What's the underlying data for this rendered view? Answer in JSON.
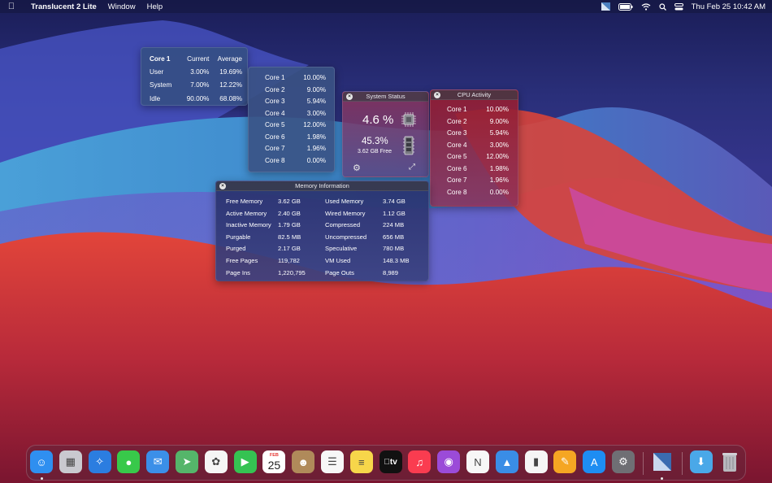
{
  "menubar": {
    "app_name": "Translucent 2 Lite",
    "menus": [
      "Window",
      "Help"
    ],
    "clock": "Thu Feb 25  10:42 AM"
  },
  "core_detail": {
    "headers": [
      "Core 1",
      "Current",
      "Average"
    ],
    "rows": [
      {
        "label": "User",
        "current": "3.00%",
        "average": "19.69%"
      },
      {
        "label": "System",
        "current": "7.00%",
        "average": "12.22%"
      },
      {
        "label": "Idle",
        "current": "90.00%",
        "average": "68.08%"
      }
    ]
  },
  "core_list": [
    {
      "name": "Core 1",
      "value": "10.00%"
    },
    {
      "name": "Core 2",
      "value": "9.00%"
    },
    {
      "name": "Core 3",
      "value": "5.94%"
    },
    {
      "name": "Core 4",
      "value": "3.00%"
    },
    {
      "name": "Core 5",
      "value": "12.00%"
    },
    {
      "name": "Core 6",
      "value": "1.98%"
    },
    {
      "name": "Core 7",
      "value": "1.96%"
    },
    {
      "name": "Core 8",
      "value": "0.00%"
    }
  ],
  "system_status": {
    "title": "System Status",
    "cpu_usage": "4.6 %",
    "memory_usage": "45.3%",
    "memory_free": "3.62 GB Free"
  },
  "cpu_activity": {
    "title": "CPU Activity",
    "cores": [
      {
        "name": "Core 1",
        "value": "10.00%"
      },
      {
        "name": "Core 2",
        "value": "9.00%"
      },
      {
        "name": "Core 3",
        "value": "5.94%"
      },
      {
        "name": "Core 4",
        "value": "3.00%"
      },
      {
        "name": "Core 5",
        "value": "12.00%"
      },
      {
        "name": "Core 6",
        "value": "1.98%"
      },
      {
        "name": "Core 7",
        "value": "1.96%"
      },
      {
        "name": "Core 8",
        "value": "0.00%"
      }
    ]
  },
  "memory_info": {
    "title": "Memory Information",
    "rows": [
      {
        "k1": "Free Memory",
        "v1": "3.62 GB",
        "k2": "Used Memory",
        "v2": "3.74 GB"
      },
      {
        "k1": "Active Memory",
        "v1": "2.40 GB",
        "k2": "Wired Memory",
        "v2": "1.12 GB"
      },
      {
        "k1": "Inactive Memory",
        "v1": "1.79 GB",
        "k2": "Compressed",
        "v2": "224 MB"
      },
      {
        "k1": "Purgable",
        "v1": "82.5 MB",
        "k2": "Uncompressed",
        "v2": "656 MB"
      },
      {
        "k1": "Purged",
        "v1": "2.17 GB",
        "k2": "Speculative",
        "v2": "780 MB"
      },
      {
        "k1": "Free Pages",
        "v1": "119,782",
        "k2": "VM Used",
        "v2": "148.3 MB"
      },
      {
        "k1": "Page Ins",
        "v1": "1,220,795",
        "k2": "Page Outs",
        "v2": "8,989"
      }
    ]
  },
  "dock": {
    "calendar_month": "FEB",
    "calendar_day": "25",
    "tv_label": "tv",
    "apps": [
      {
        "name": "finder",
        "icon": "finder-icon",
        "color": "#2f8ff0",
        "glyph": "☺",
        "running": true
      },
      {
        "name": "launchpad",
        "icon": "launchpad-icon",
        "color": "#c9c9cf",
        "glyph": "▦",
        "running": false
      },
      {
        "name": "safari",
        "icon": "safari-icon",
        "color": "#2b7de0",
        "glyph": "✧",
        "running": false
      },
      {
        "name": "messages",
        "icon": "messages-icon",
        "color": "#38c94a",
        "glyph": "●",
        "running": false
      },
      {
        "name": "mail",
        "icon": "mail-icon",
        "color": "#3b8fe8",
        "glyph": "✉",
        "running": false
      },
      {
        "name": "maps",
        "icon": "maps-icon",
        "color": "#55b56a",
        "glyph": "➤",
        "running": false
      },
      {
        "name": "photos",
        "icon": "photos-icon",
        "color": "#f5f5f5",
        "glyph": "✿",
        "running": false
      },
      {
        "name": "facetime",
        "icon": "facetime-icon",
        "color": "#35c352",
        "glyph": "▶",
        "running": false
      },
      {
        "name": "calendar",
        "icon": "calendar-icon",
        "color": "#ffffff",
        "glyph": "",
        "running": false
      },
      {
        "name": "contacts",
        "icon": "contacts-icon",
        "color": "#b08a5a",
        "glyph": "☻",
        "running": false
      },
      {
        "name": "reminders",
        "icon": "reminders-icon",
        "color": "#f7f7f7",
        "glyph": "☰",
        "running": false
      },
      {
        "name": "notes",
        "icon": "notes-icon",
        "color": "#f7d64a",
        "glyph": "≡",
        "running": false
      },
      {
        "name": "tv",
        "icon": "tv-icon",
        "color": "#111111",
        "glyph": "",
        "running": false
      },
      {
        "name": "music",
        "icon": "music-icon",
        "color": "#fa3c50",
        "glyph": "♫",
        "running": false
      },
      {
        "name": "podcasts",
        "icon": "podcasts-icon",
        "color": "#9b4bd8",
        "glyph": "◉",
        "running": false
      },
      {
        "name": "news",
        "icon": "news-icon",
        "color": "#f7f7f7",
        "glyph": "N",
        "running": false
      },
      {
        "name": "keynote",
        "icon": "keynote-icon",
        "color": "#3a8de6",
        "glyph": "▲",
        "running": false
      },
      {
        "name": "numbers",
        "icon": "numbers-icon",
        "color": "#f5f5f5",
        "glyph": "▮",
        "running": false
      },
      {
        "name": "pages",
        "icon": "pages-icon",
        "color": "#f5a623",
        "glyph": "✎",
        "running": false
      },
      {
        "name": "app-store",
        "icon": "app-store-icon",
        "color": "#1e8df2",
        "glyph": "A",
        "running": false
      },
      {
        "name": "system-preferences",
        "icon": "system-preferences-icon",
        "color": "#6f6f74",
        "glyph": "⚙",
        "running": false
      },
      {
        "name": "translucent",
        "icon": "translucent-app-icon",
        "color": "#2e4c86",
        "glyph": "◢",
        "running": true
      },
      {
        "name": "downloads",
        "icon": "downloads-folder-icon",
        "color": "#4aa8e8",
        "glyph": "⬇",
        "running": false
      },
      {
        "name": "trash",
        "icon": "trash-icon",
        "color": "#9a9aa0",
        "glyph": "🗑",
        "running": false
      }
    ]
  }
}
